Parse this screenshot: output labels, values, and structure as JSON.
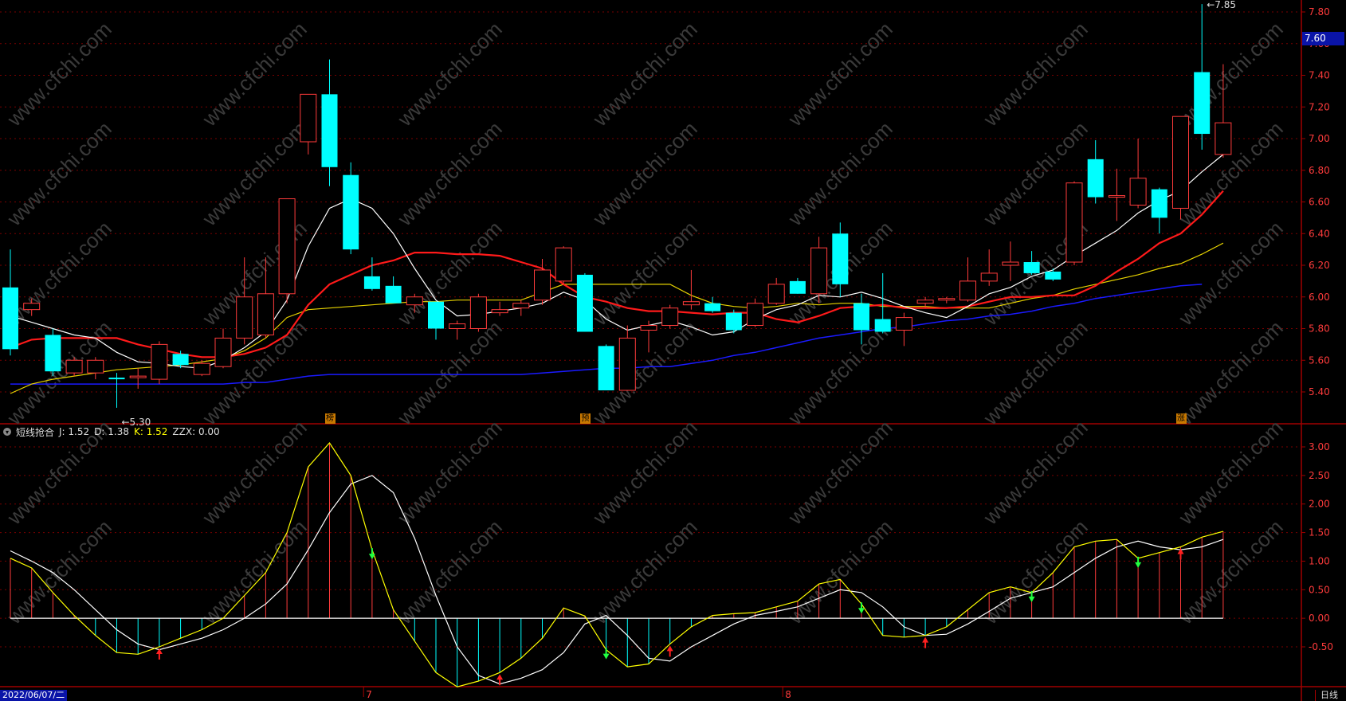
{
  "colors": {
    "up": "#ff3b3b",
    "down": "#00ffff",
    "grid": "#7a0000",
    "ma5": "#ffffff",
    "ma10": "#ff1a1a",
    "ma20": "#e6d200",
    "ma60": "#1a1aff",
    "k_line": "#ffff00",
    "d_line": "#ffffff"
  },
  "header": {
    "indicator_name": "短线抢合",
    "j_text": "J: 1.52",
    "d_text": "D: 1.38",
    "k_text": "K: 1.52",
    "zzx_text": "ZZX: 0.00"
  },
  "price_tag": "7.60",
  "date_label": "2022/06/07/二",
  "period_label": "日线",
  "markers": [
    {
      "label": "榜",
      "idx": 15
    },
    {
      "label": "预",
      "idx": 27
    },
    {
      "label": "涨",
      "idx": 55
    }
  ],
  "watermark": "www.cfchi.com",
  "chart_data": [
    {
      "type": "candlestick",
      "y_ticks": [
        "7.80",
        "7.60",
        "7.40",
        "7.20",
        "7.00",
        "6.80",
        "6.60",
        "6.40",
        "6.20",
        "6.00",
        "5.80",
        "5.60",
        "5.40"
      ],
      "ylim": [
        5.2,
        7.92
      ],
      "x_tick_labels": [
        "7",
        "8"
      ],
      "annotations": [
        {
          "text": "7.85",
          "idx": 56,
          "value": 7.85
        },
        {
          "text": "5.30",
          "idx": 5,
          "value": 5.3
        }
      ],
      "candles": [
        {
          "o": 6.06,
          "h": 6.3,
          "l": 5.63,
          "c": 5.67
        },
        {
          "o": 5.92,
          "h": 5.99,
          "l": 5.88,
          "c": 5.96
        },
        {
          "o": 5.76,
          "h": 5.8,
          "l": 5.5,
          "c": 5.53
        },
        {
          "o": 5.52,
          "h": 5.62,
          "l": 5.5,
          "c": 5.6
        },
        {
          "o": 5.52,
          "h": 5.62,
          "l": 5.48,
          "c": 5.6
        },
        {
          "o": 5.49,
          "h": 5.52,
          "l": 5.3,
          "c": 5.48
        },
        {
          "o": 5.49,
          "h": 5.55,
          "l": 5.42,
          "c": 5.5
        },
        {
          "o": 5.48,
          "h": 5.72,
          "l": 5.45,
          "c": 5.7
        },
        {
          "o": 5.64,
          "h": 5.66,
          "l": 5.55,
          "c": 5.57
        },
        {
          "o": 5.51,
          "h": 5.6,
          "l": 5.5,
          "c": 5.58
        },
        {
          "o": 5.56,
          "h": 5.8,
          "l": 5.55,
          "c": 5.74
        },
        {
          "o": 5.74,
          "h": 6.25,
          "l": 5.7,
          "c": 6.0
        },
        {
          "o": 5.76,
          "h": 6.25,
          "l": 5.74,
          "c": 6.02
        },
        {
          "o": 6.02,
          "h": 6.62,
          "l": 5.96,
          "c": 6.62
        },
        {
          "o": 6.98,
          "h": 7.28,
          "l": 6.9,
          "c": 7.28
        },
        {
          "o": 7.28,
          "h": 7.5,
          "l": 6.7,
          "c": 6.82
        },
        {
          "o": 6.77,
          "h": 6.85,
          "l": 6.27,
          "c": 6.3
        },
        {
          "o": 6.13,
          "h": 6.25,
          "l": 6.04,
          "c": 6.05
        },
        {
          "o": 6.07,
          "h": 6.13,
          "l": 5.96,
          "c": 5.96
        },
        {
          "o": 5.95,
          "h": 6.02,
          "l": 5.9,
          "c": 6.0
        },
        {
          "o": 5.97,
          "h": 5.97,
          "l": 5.73,
          "c": 5.8
        },
        {
          "o": 5.8,
          "h": 5.85,
          "l": 5.73,
          "c": 5.83
        },
        {
          "o": 5.8,
          "h": 6.02,
          "l": 5.78,
          "c": 6.0
        },
        {
          "o": 5.9,
          "h": 5.97,
          "l": 5.88,
          "c": 5.92
        },
        {
          "o": 5.93,
          "h": 5.98,
          "l": 5.88,
          "c": 5.96
        },
        {
          "o": 5.98,
          "h": 6.24,
          "l": 5.95,
          "c": 6.17
        },
        {
          "o": 6.1,
          "h": 6.32,
          "l": 6.08,
          "c": 6.31
        },
        {
          "o": 6.14,
          "h": 6.15,
          "l": 5.78,
          "c": 5.78
        },
        {
          "o": 5.69,
          "h": 5.7,
          "l": 5.41,
          "c": 5.41
        },
        {
          "o": 5.41,
          "h": 5.82,
          "l": 5.41,
          "c": 5.74
        },
        {
          "o": 5.79,
          "h": 5.85,
          "l": 5.65,
          "c": 5.82
        },
        {
          "o": 5.82,
          "h": 5.95,
          "l": 5.8,
          "c": 5.93
        },
        {
          "o": 5.95,
          "h": 6.17,
          "l": 5.92,
          "c": 5.97
        },
        {
          "o": 5.96,
          "h": 6.0,
          "l": 5.9,
          "c": 5.91
        },
        {
          "o": 5.9,
          "h": 5.92,
          "l": 5.77,
          "c": 5.79
        },
        {
          "o": 5.82,
          "h": 5.99,
          "l": 5.81,
          "c": 5.96
        },
        {
          "o": 5.96,
          "h": 6.12,
          "l": 5.95,
          "c": 6.08
        },
        {
          "o": 6.1,
          "h": 6.12,
          "l": 6.02,
          "c": 6.02
        },
        {
          "o": 6.02,
          "h": 6.38,
          "l": 5.96,
          "c": 6.31
        },
        {
          "o": 6.4,
          "h": 6.47,
          "l": 6.0,
          "c": 6.08
        },
        {
          "o": 5.96,
          "h": 6.02,
          "l": 5.7,
          "c": 5.79
        },
        {
          "o": 5.86,
          "h": 6.15,
          "l": 5.77,
          "c": 5.78
        },
        {
          "o": 5.79,
          "h": 5.9,
          "l": 5.69,
          "c": 5.87
        },
        {
          "o": 5.96,
          "h": 6.0,
          "l": 5.93,
          "c": 5.98
        },
        {
          "o": 5.98,
          "h": 6.0,
          "l": 5.96,
          "c": 5.99
        },
        {
          "o": 5.98,
          "h": 6.25,
          "l": 5.97,
          "c": 6.1
        },
        {
          "o": 6.1,
          "h": 6.3,
          "l": 6.07,
          "c": 6.15
        },
        {
          "o": 6.2,
          "h": 6.35,
          "l": 6.1,
          "c": 6.22
        },
        {
          "o": 6.22,
          "h": 6.29,
          "l": 6.14,
          "c": 6.15
        },
        {
          "o": 6.16,
          "h": 6.18,
          "l": 6.1,
          "c": 6.11
        },
        {
          "o": 6.22,
          "h": 6.73,
          "l": 6.2,
          "c": 6.72
        },
        {
          "o": 6.87,
          "h": 6.99,
          "l": 6.59,
          "c": 6.63
        },
        {
          "o": 6.63,
          "h": 6.81,
          "l": 6.48,
          "c": 6.64
        },
        {
          "o": 6.58,
          "h": 7.0,
          "l": 6.56,
          "c": 6.75
        },
        {
          "o": 6.68,
          "h": 6.69,
          "l": 6.4,
          "c": 6.5
        },
        {
          "o": 6.56,
          "h": 7.14,
          "l": 6.49,
          "c": 7.14
        },
        {
          "o": 7.42,
          "h": 7.85,
          "l": 6.93,
          "c": 7.03
        },
        {
          "o": 6.9,
          "h": 7.47,
          "l": 6.88,
          "c": 7.1
        }
      ],
      "ma5": [
        5.88,
        5.84,
        5.8,
        5.76,
        5.74,
        5.65,
        5.59,
        5.58,
        5.56,
        5.55,
        5.6,
        5.68,
        5.78,
        5.98,
        6.32,
        6.56,
        6.62,
        6.56,
        6.4,
        6.18,
        5.98,
        5.88,
        5.89,
        5.91,
        5.93,
        5.96,
        6.03,
        5.98,
        5.86,
        5.79,
        5.82,
        5.85,
        5.81,
        5.76,
        5.78,
        5.86,
        5.92,
        5.95,
        6.01,
        6.0,
        6.03,
        5.99,
        5.94,
        5.9,
        5.87,
        5.94,
        6.02,
        6.06,
        6.13,
        6.17,
        6.26,
        6.34,
        6.42,
        6.53,
        6.61,
        6.67,
        6.79,
        6.9
      ],
      "ma10": [
        5.68,
        5.73,
        5.74,
        5.74,
        5.74,
        5.74,
        5.7,
        5.67,
        5.64,
        5.62,
        5.62,
        5.64,
        5.68,
        5.76,
        5.95,
        6.08,
        6.14,
        6.2,
        6.23,
        6.28,
        6.28,
        6.27,
        6.27,
        6.26,
        6.22,
        6.18,
        6.08,
        6.0,
        5.97,
        5.93,
        5.91,
        5.91,
        5.9,
        5.89,
        5.9,
        5.9,
        5.86,
        5.84,
        5.88,
        5.93,
        5.94,
        5.95,
        5.93,
        5.93,
        5.93,
        5.94,
        5.97,
        6.0,
        6.0,
        6.01,
        6.01,
        6.07,
        6.16,
        6.24,
        6.34,
        6.4,
        6.52,
        6.67
      ],
      "ma20": [
        5.39,
        5.45,
        5.48,
        5.5,
        5.52,
        5.54,
        5.55,
        5.56,
        5.57,
        5.59,
        5.61,
        5.66,
        5.74,
        5.87,
        5.92,
        5.93,
        5.94,
        5.95,
        5.96,
        5.97,
        5.97,
        5.98,
        5.98,
        5.98,
        5.98,
        6.03,
        6.08,
        6.08,
        6.08,
        6.08,
        6.08,
        6.08,
        6.01,
        5.96,
        5.94,
        5.93,
        5.94,
        5.96,
        5.95,
        5.96,
        5.96,
        5.94,
        5.94,
        5.94,
        5.93,
        5.93,
        5.93,
        5.96,
        5.99,
        6.01,
        6.05,
        6.08,
        6.11,
        6.14,
        6.18,
        6.21,
        6.27,
        6.34
      ],
      "ma60": [
        5.45,
        5.45,
        5.45,
        5.45,
        5.45,
        5.45,
        5.45,
        5.45,
        5.45,
        5.45,
        5.45,
        5.46,
        5.46,
        5.48,
        5.5,
        5.51,
        5.51,
        5.51,
        5.51,
        5.51,
        5.51,
        5.51,
        5.51,
        5.51,
        5.51,
        5.52,
        5.53,
        5.54,
        5.55,
        5.55,
        5.56,
        5.56,
        5.58,
        5.6,
        5.63,
        5.65,
        5.68,
        5.71,
        5.74,
        5.76,
        5.78,
        5.8,
        5.81,
        5.83,
        5.85,
        5.86,
        5.88,
        5.89,
        5.91,
        5.94,
        5.96,
        5.99,
        6.01,
        6.03,
        6.05,
        6.07,
        6.08
      ]
    },
    {
      "type": "line",
      "title": "短线抢合",
      "y_ticks": [
        "3.00",
        "2.50",
        "2.00",
        "1.50",
        "1.00",
        "0.50",
        "0.00",
        "-0.50"
      ],
      "ylim": [
        -1.25,
        3.25
      ],
      "series": [
        {
          "name": "K",
          "values": [
            1.05,
            0.88,
            0.45,
            0.05,
            -0.3,
            -0.6,
            -0.63,
            -0.5,
            -0.35,
            -0.2,
            0.0,
            0.4,
            0.8,
            1.5,
            2.65,
            3.07,
            2.5,
            1.2,
            0.15,
            -0.4,
            -0.95,
            -1.2,
            -1.1,
            -0.95,
            -0.7,
            -0.35,
            0.18,
            0.04,
            -0.55,
            -0.85,
            -0.8,
            -0.45,
            -0.15,
            0.05,
            0.08,
            0.1,
            0.2,
            0.3,
            0.6,
            0.68,
            0.25,
            -0.3,
            -0.33,
            -0.3,
            -0.15,
            0.15,
            0.45,
            0.55,
            0.45,
            0.8,
            1.25,
            1.35,
            1.38,
            1.05,
            1.15,
            1.25,
            1.42,
            1.52
          ]
        },
        {
          "name": "D",
          "values": [
            1.18,
            1.0,
            0.8,
            0.5,
            0.15,
            -0.2,
            -0.45,
            -0.55,
            -0.45,
            -0.35,
            -0.2,
            0.0,
            0.25,
            0.6,
            1.2,
            1.85,
            2.35,
            2.5,
            2.2,
            1.4,
            0.4,
            -0.5,
            -1.0,
            -1.15,
            -1.05,
            -0.9,
            -0.6,
            -0.1,
            0.05,
            -0.3,
            -0.7,
            -0.75,
            -0.5,
            -0.3,
            -0.1,
            0.05,
            0.12,
            0.2,
            0.35,
            0.5,
            0.45,
            0.2,
            -0.15,
            -0.3,
            -0.28,
            -0.1,
            0.12,
            0.35,
            0.45,
            0.55,
            0.8,
            1.05,
            1.25,
            1.35,
            1.25,
            1.2,
            1.25,
            1.38
          ]
        }
      ]
    }
  ]
}
